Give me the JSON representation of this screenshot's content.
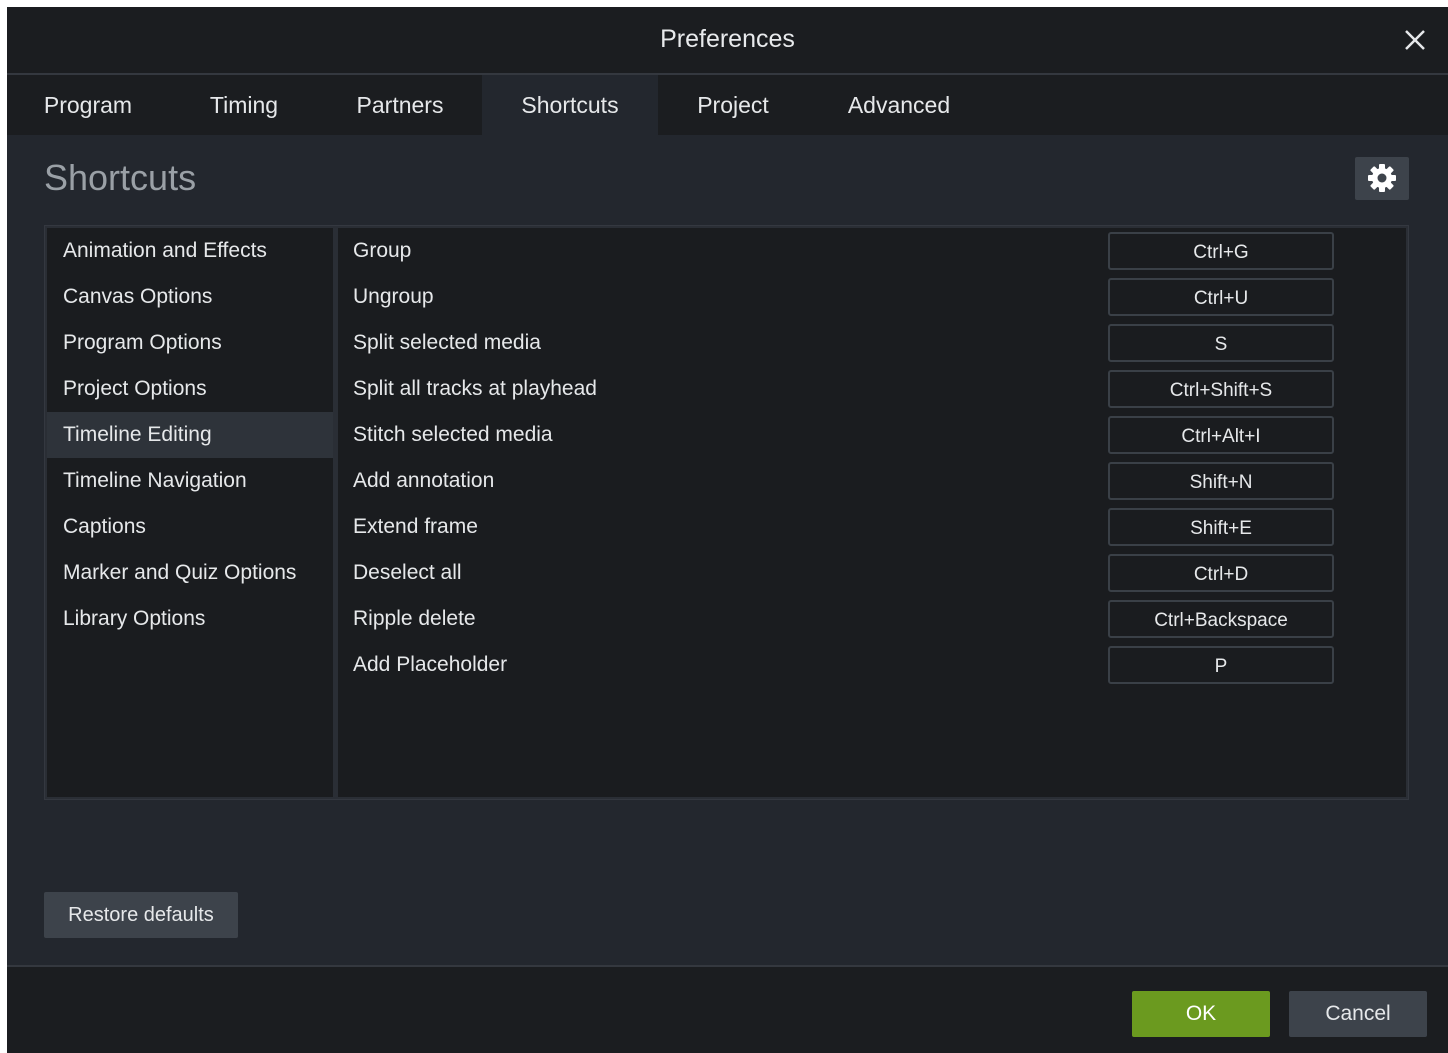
{
  "window": {
    "title": "Preferences"
  },
  "tabs": [
    {
      "label": "Program"
    },
    {
      "label": "Timing"
    },
    {
      "label": "Partners"
    },
    {
      "label": "Shortcuts",
      "active": true
    },
    {
      "label": "Project"
    },
    {
      "label": "Advanced"
    }
  ],
  "section": {
    "heading": "Shortcuts",
    "settings_icon": "gear-icon"
  },
  "categories": [
    {
      "label": "Animation and Effects"
    },
    {
      "label": "Canvas Options"
    },
    {
      "label": "Program Options"
    },
    {
      "label": "Project Options"
    },
    {
      "label": "Timeline Editing",
      "active": true
    },
    {
      "label": "Timeline Navigation"
    },
    {
      "label": "Captions"
    },
    {
      "label": "Marker and Quiz Options"
    },
    {
      "label": "Library Options"
    }
  ],
  "shortcuts": [
    {
      "action": "Group",
      "keys": "Ctrl+G"
    },
    {
      "action": "Ungroup",
      "keys": "Ctrl+U"
    },
    {
      "action": "Split selected media",
      "keys": "S"
    },
    {
      "action": "Split all tracks at playhead",
      "keys": "Ctrl+Shift+S"
    },
    {
      "action": "Stitch selected media",
      "keys": "Ctrl+Alt+I"
    },
    {
      "action": "Add annotation",
      "keys": "Shift+N"
    },
    {
      "action": "Extend frame",
      "keys": "Shift+E"
    },
    {
      "action": "Deselect all",
      "keys": "Ctrl+D"
    },
    {
      "action": "Ripple delete",
      "keys": "Ctrl+Backspace"
    },
    {
      "action": "Add Placeholder",
      "keys": "P"
    }
  ],
  "buttons": {
    "restore_defaults": "Restore defaults",
    "ok": "OK",
    "cancel": "Cancel"
  },
  "colors": {
    "ok_green": "#6b9a1f",
    "background": "#23272e",
    "panel": "#1a1c1f"
  }
}
